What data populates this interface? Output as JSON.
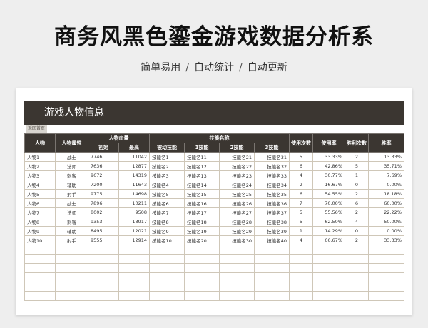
{
  "header": {
    "title": "商务风黑色鎏金游戏数据分析系",
    "subtitle": [
      "简单易用",
      "自动统计",
      "自动更新"
    ],
    "separator": "/"
  },
  "sheet": {
    "banner": "游戏人物信息",
    "back_button": "返回首页",
    "columns": {
      "character": "人物",
      "attribute": "人物属性",
      "hp_group": "人物血量",
      "hp_initial": "初始",
      "hp_max": "最高",
      "skill_group": "技能名称",
      "skill_passive": "被动技能",
      "skill_1": "1技能",
      "skill_2": "2技能",
      "skill_3": "3技能",
      "use_count": "使用次数",
      "use_rate": "使用率",
      "win_count": "胜利次数",
      "win_rate": "胜率"
    },
    "rows": [
      {
        "name": "人物1",
        "attr": "战士",
        "hp_init": "7746",
        "hp_max": "11042",
        "passive": "技能名1",
        "s1": "技能名11",
        "s2": "技能名21",
        "s3": "技能名31",
        "use": "5",
        "use_rate": "33.33%",
        "win": "2",
        "win_rate": "13.33%"
      },
      {
        "name": "人物2",
        "attr": "法师",
        "hp_init": "7636",
        "hp_max": "12877",
        "passive": "技能名2",
        "s1": "技能名12",
        "s2": "技能名22",
        "s3": "技能名32",
        "use": "6",
        "use_rate": "42.86%",
        "win": "5",
        "win_rate": "35.71%"
      },
      {
        "name": "人物3",
        "attr": "刺客",
        "hp_init": "9672",
        "hp_max": "14319",
        "passive": "技能名3",
        "s1": "技能名13",
        "s2": "技能名23",
        "s3": "技能名33",
        "use": "4",
        "use_rate": "30.77%",
        "win": "1",
        "win_rate": "7.69%"
      },
      {
        "name": "人物4",
        "attr": "辅助",
        "hp_init": "7200",
        "hp_max": "11643",
        "passive": "技能名4",
        "s1": "技能名14",
        "s2": "技能名24",
        "s3": "技能名34",
        "use": "2",
        "use_rate": "16.67%",
        "win": "0",
        "win_rate": "0.00%"
      },
      {
        "name": "人物5",
        "attr": "射手",
        "hp_init": "9775",
        "hp_max": "14698",
        "passive": "技能名5",
        "s1": "技能名15",
        "s2": "技能名25",
        "s3": "技能名35",
        "use": "6",
        "use_rate": "54.55%",
        "win": "2",
        "win_rate": "18.18%"
      },
      {
        "name": "人物6",
        "attr": "战士",
        "hp_init": "7896",
        "hp_max": "10211",
        "passive": "技能名6",
        "s1": "技能名16",
        "s2": "技能名26",
        "s3": "技能名36",
        "use": "7",
        "use_rate": "70.00%",
        "win": "6",
        "win_rate": "60.00%"
      },
      {
        "name": "人物7",
        "attr": "法师",
        "hp_init": "8002",
        "hp_max": "9508",
        "passive": "技能名7",
        "s1": "技能名17",
        "s2": "技能名27",
        "s3": "技能名37",
        "use": "5",
        "use_rate": "55.56%",
        "win": "2",
        "win_rate": "22.22%"
      },
      {
        "name": "人物8",
        "attr": "刺客",
        "hp_init": "9353",
        "hp_max": "13917",
        "passive": "技能名8",
        "s1": "技能名18",
        "s2": "技能名28",
        "s3": "技能名38",
        "use": "5",
        "use_rate": "62.50%",
        "win": "4",
        "win_rate": "50.00%"
      },
      {
        "name": "人物9",
        "attr": "辅助",
        "hp_init": "8495",
        "hp_max": "12021",
        "passive": "技能名9",
        "s1": "技能名19",
        "s2": "技能名29",
        "s3": "技能名39",
        "use": "1",
        "use_rate": "14.29%",
        "win": "0",
        "win_rate": "0.00%"
      },
      {
        "name": "人物10",
        "attr": "射手",
        "hp_init": "9555",
        "hp_max": "12914",
        "passive": "技能名10",
        "s1": "技能名20",
        "s2": "技能名30",
        "s3": "技能名40",
        "use": "4",
        "use_rate": "66.67%",
        "win": "2",
        "win_rate": "33.33%"
      }
    ]
  },
  "colors": {
    "header_dark": "#3b3631",
    "grid_line": "#cfc7b8",
    "background": "#eeeeee"
  }
}
